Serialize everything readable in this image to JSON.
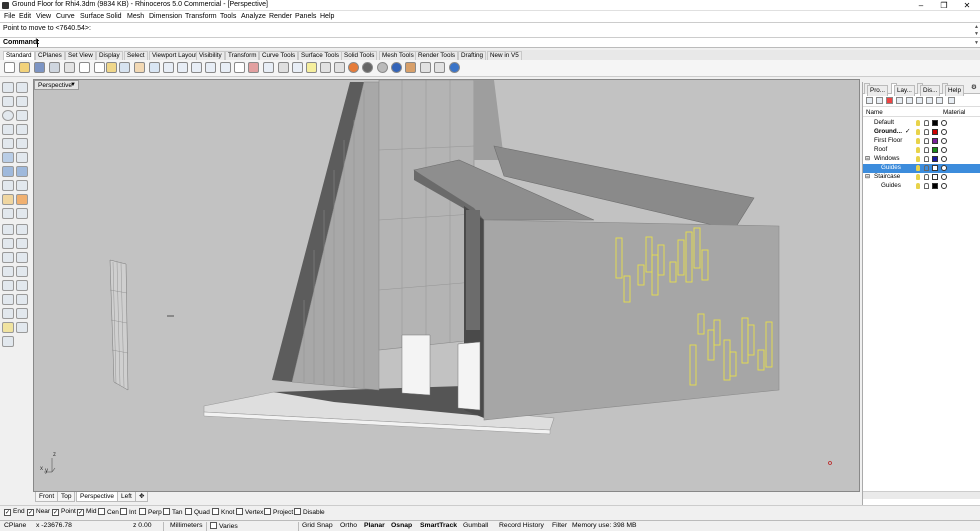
{
  "window": {
    "title": "Ground Floor for Rhi4.3dm (9834 KB) - Rhinoceros 5.0 Commercial - [Perspective]"
  },
  "menu": [
    "File",
    "Edit",
    "View",
    "Curve",
    "Surface",
    "Solid",
    "Mesh",
    "Dimension",
    "Transform",
    "Tools",
    "Analyze",
    "Render",
    "Panels",
    "Help"
  ],
  "history": {
    "line": "Point to move to <7640.54>:"
  },
  "command": {
    "label": "Command:",
    "value": ""
  },
  "toolbar_tabs": [
    "Standard",
    "CPlanes",
    "Set View",
    "Display",
    "Select",
    "Viewport Layout",
    "Visibility",
    "Transform",
    "Curve Tools",
    "Surface Tools",
    "Solid Tools",
    "Mesh Tools",
    "Render Tools",
    "Drafting",
    "New in V5"
  ],
  "active_tab": "Standard",
  "viewport": {
    "label": "Perspective",
    "axis_y": "y",
    "axis_z": "z",
    "axis_x": "x"
  },
  "view_tabs": [
    "Front",
    "Top",
    "Perspective",
    "Left"
  ],
  "active_view": "Perspective",
  "osnaps": [
    {
      "label": "End",
      "checked": true
    },
    {
      "label": "Near",
      "checked": true
    },
    {
      "label": "Point",
      "checked": true
    },
    {
      "label": "Mid",
      "checked": true
    },
    {
      "label": "Cen",
      "checked": false
    },
    {
      "label": "Int",
      "checked": false
    },
    {
      "label": "Perp",
      "checked": false
    },
    {
      "label": "Tan",
      "checked": false
    },
    {
      "label": "Quad",
      "checked": false
    },
    {
      "label": "Knot",
      "checked": false
    },
    {
      "label": "Vertex",
      "checked": false
    },
    {
      "label": "Project",
      "checked": false
    },
    {
      "label": "Disable",
      "checked": false
    }
  ],
  "status": {
    "cplane": "CPlane",
    "x": "x -23676.78",
    "z": "z 0.00",
    "units": "Millimeters",
    "layer": "Varies",
    "items": [
      "Grid Snap",
      "Ortho",
      "Planar",
      "Osnap",
      "SmartTrack",
      "Gumball",
      "Record History",
      "Filter"
    ],
    "bold": [
      "Planar",
      "Osnap",
      "SmartTrack"
    ],
    "memory": "Memory use: 398 MB"
  },
  "panel": {
    "tabs": [
      "Pro...",
      "Lay...",
      "Dis...",
      "Help"
    ],
    "active_tab": "Lay...",
    "headers": {
      "name": "Name",
      "material": "Material"
    },
    "layers": [
      {
        "name": "Default",
        "indent": 1,
        "color": "#000000",
        "current": false,
        "selected": false,
        "bold": false,
        "expander": ""
      },
      {
        "name": "Ground...",
        "indent": 1,
        "color": "#cc0000",
        "current": true,
        "selected": false,
        "bold": true,
        "expander": ""
      },
      {
        "name": "First Floor",
        "indent": 1,
        "color": "#7a1f9a",
        "current": false,
        "selected": false,
        "bold": false,
        "expander": ""
      },
      {
        "name": "Roof",
        "indent": 1,
        "color": "#1a8a1a",
        "current": false,
        "selected": false,
        "bold": false,
        "expander": ""
      },
      {
        "name": "Windows",
        "indent": 1,
        "color": "#1a1aa0",
        "current": false,
        "selected": false,
        "bold": false,
        "expander": "⊟"
      },
      {
        "name": "Guides",
        "indent": 2,
        "color": "#ffffff",
        "current": false,
        "selected": true,
        "bold": false,
        "expander": ""
      },
      {
        "name": "Staircase",
        "indent": 1,
        "color": "#ffffff",
        "current": false,
        "selected": false,
        "bold": false,
        "expander": "⊟"
      },
      {
        "name": "Guides",
        "indent": 2,
        "color": "#000000",
        "current": false,
        "selected": false,
        "bold": false,
        "expander": ""
      }
    ],
    "current_mark": "✓"
  },
  "colors": {
    "viewport_bg": "#c2c2c2",
    "selection": "#3c8cdc",
    "guide_curves": "#e8e04a"
  }
}
